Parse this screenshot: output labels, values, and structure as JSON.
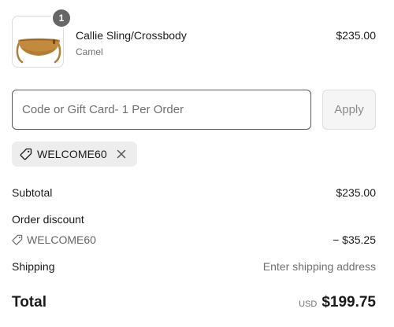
{
  "product": {
    "name": "Callie Sling/Crossbody",
    "variant": "Camel",
    "price": "$235.00",
    "quantity": "1",
    "image_alt": "Camel leather sling bag"
  },
  "discount_form": {
    "placeholder": "Code or Gift Card- 1 Per Order",
    "apply_label": "Apply"
  },
  "applied_code": {
    "code": "WELCOME60",
    "tag_icon": "tag-icon",
    "remove_icon": "close-icon"
  },
  "summary": {
    "subtotal_label": "Subtotal",
    "subtotal_value": "$235.00",
    "order_discount_label": "Order discount",
    "discount_code": "WELCOME60",
    "discount_value": "− $35.25",
    "shipping_label": "Shipping",
    "shipping_value": "Enter shipping address",
    "total_label": "Total",
    "currency": "USD",
    "total_value": "$199.75"
  },
  "colors": {
    "text": "#1a1a1a",
    "muted": "#707070",
    "badge": "#666666",
    "chip_bg": "#ededed",
    "input_border": "#575757",
    "button_bg": "#f5f5f5",
    "bag_color": "#c18a3e"
  }
}
